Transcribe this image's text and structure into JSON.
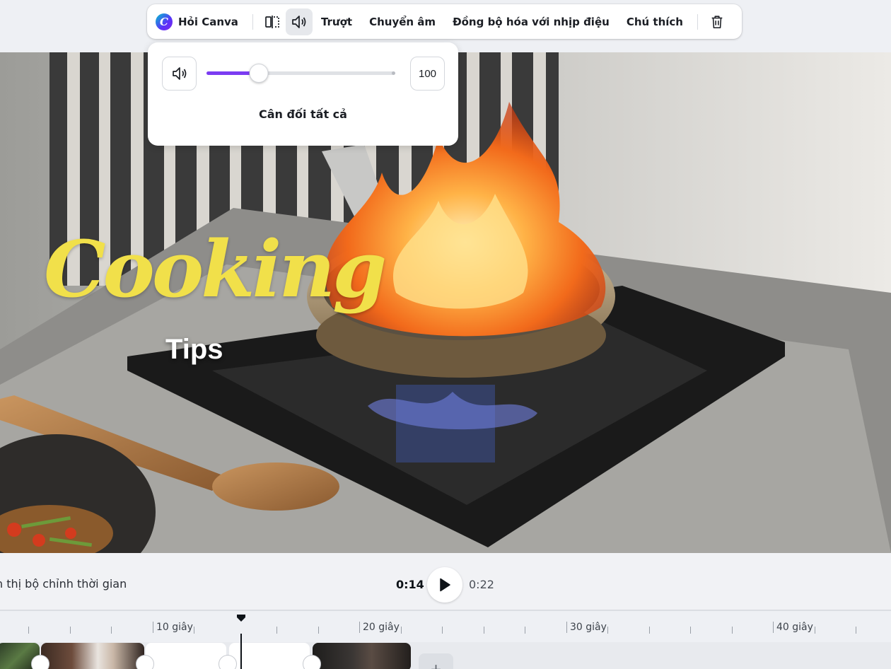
{
  "toolbar": {
    "ask_canva": "Hỏi Canva",
    "slide": "Trượt",
    "transcribe": "Chuyển âm",
    "sync_beat": "Đồng bộ hóa với nhịp điệu",
    "caption": "Chú thích"
  },
  "volume_popover": {
    "value": "100",
    "level": 0.28,
    "balance_all": "Cân đối tất cả",
    "accent_color": "#7b3cf2"
  },
  "canvas": {
    "title_script": "Cooking",
    "title_sub": "Tips",
    "title_color": "#f1e04a"
  },
  "playback": {
    "timer_label": "n thị bộ chỉnh thời gian",
    "current_time": "0:14",
    "total_time": "0:22"
  },
  "timeline": {
    "labels": [
      "10 giây",
      "20 giây",
      "30 giây",
      "40 giây"
    ]
  },
  "icons": {
    "ask_canva": "canva-logo-icon",
    "flip": "flip-icon",
    "volume": "speaker-icon",
    "delete": "trash-icon",
    "play": "play-icon",
    "add": "plus-icon"
  }
}
